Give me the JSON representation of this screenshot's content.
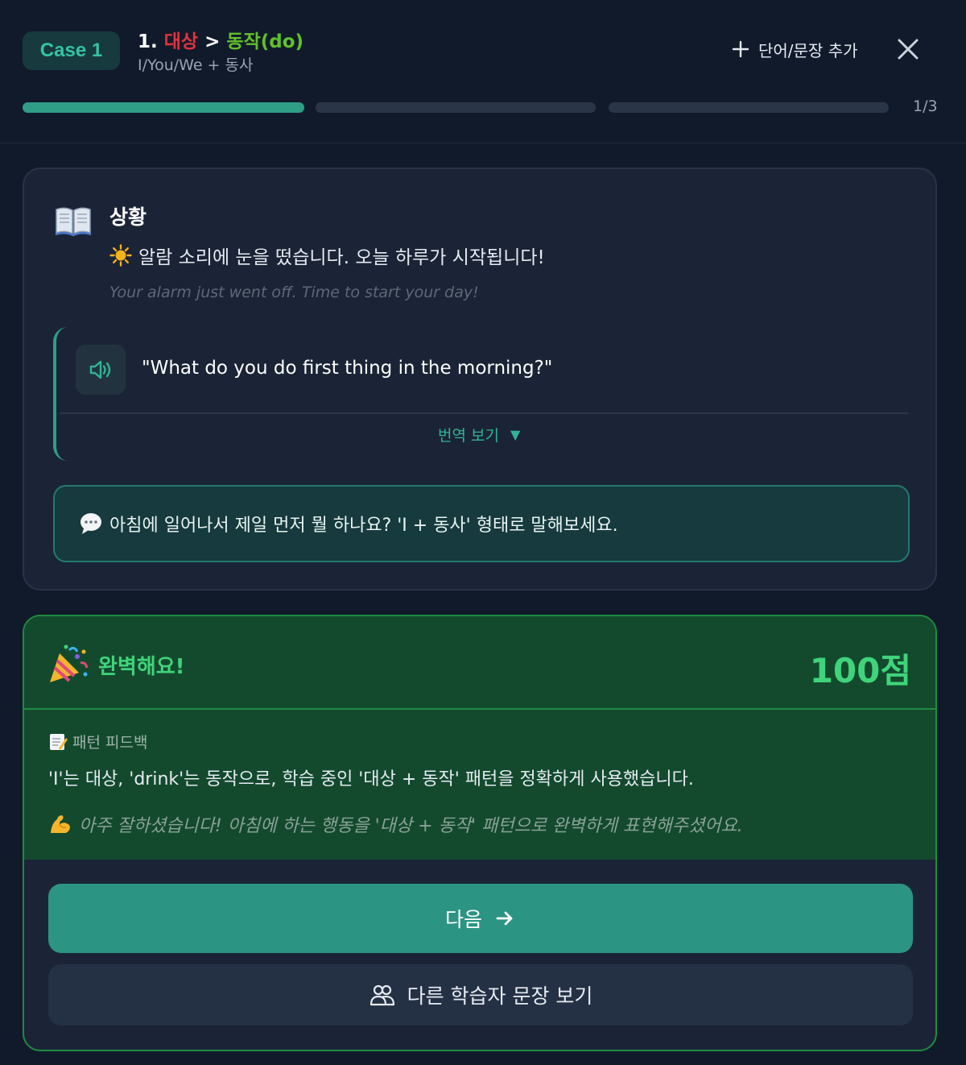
{
  "header": {
    "case_badge": "Case 1",
    "lesson_number": "1.",
    "lesson_term1": "대상",
    "lesson_separator": ">",
    "lesson_term2": "동작(do)",
    "lesson_subtitle": "I/You/We + 동사",
    "add_label": "단어/문장 추가",
    "progress_text": "1/3",
    "progress": {
      "current": 1,
      "total": 3
    }
  },
  "situation": {
    "title": "상황",
    "text_ko": "알람 소리에 눈을 떴습니다. 오늘 하루가 시작됩니다!",
    "text_en": "Your alarm just went off. Time to start your day!"
  },
  "dialogue": {
    "quote": "\"What do you do first thing in the morning?\"",
    "translate_toggle": "번역 보기",
    "translate_arrow": "▼"
  },
  "hint": {
    "text": "아침에 일어나서 제일 먼저 뭘 하나요? 'I + 동사' 형태로 말해보세요."
  },
  "result": {
    "title": "완벽해요!",
    "score": "100점",
    "feedback_label": "패턴 피드백",
    "feedback_text": "'I'는 대상, 'drink'는 동작으로, 학습 중인 '대상 + 동작' 패턴을 정확하게 사용했습니다.",
    "praise_text": "아주 잘하셨습니다! 아침에 하는 행동을 '대상 + 동작' 패턴으로 완벽하게 표현해주셨어요."
  },
  "actions": {
    "next_label": "다음",
    "others_label": "다른 학습자 문장 보기"
  },
  "colors": {
    "accent": "#2e9e87",
    "term_red": "#e3323c",
    "term_green": "#5fc12a",
    "success": "#3fd47a"
  }
}
